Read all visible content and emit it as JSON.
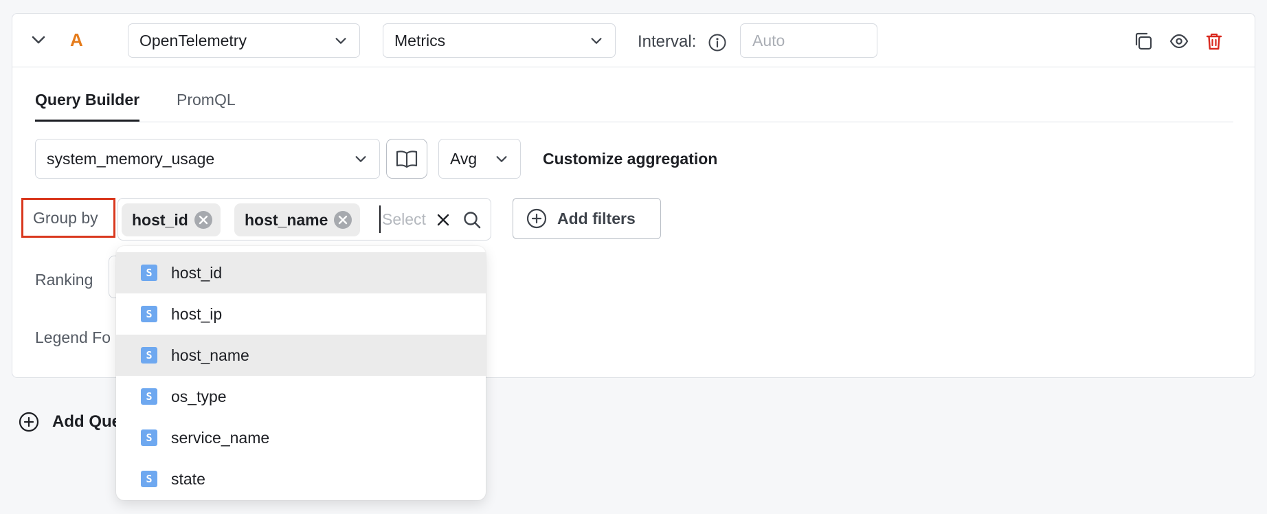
{
  "query": {
    "letter": "A",
    "datasource": "OpenTelemetry",
    "data_type": "Metrics",
    "interval_label": "Interval:",
    "interval_placeholder": "Auto"
  },
  "tabs": [
    {
      "label": "Query Builder",
      "active": true
    },
    {
      "label": "PromQL",
      "active": false
    }
  ],
  "builder": {
    "metric": "system_memory_usage",
    "aggregation": "Avg",
    "customize_aggregation": "Customize aggregation",
    "group_by_label": "Group by",
    "group_by_tags": [
      "host_id",
      "host_name"
    ],
    "group_by_placeholder": "Select",
    "add_filters": "Add filters",
    "ranking_label": "Ranking",
    "legend_label": "Legend Fo"
  },
  "dropdown": {
    "badge": "S",
    "items": [
      {
        "label": "host_id",
        "selected": true
      },
      {
        "label": "host_ip",
        "selected": false
      },
      {
        "label": "host_name",
        "selected": true
      },
      {
        "label": "os_type",
        "selected": false
      },
      {
        "label": "service_name",
        "selected": false
      },
      {
        "label": "state",
        "selected": false
      }
    ]
  },
  "footer": {
    "add_query": "Add Que"
  },
  "colors": {
    "accent_letter": "#e57c1c",
    "delete_icon": "#d9281e",
    "highlight_border": "#d9381e",
    "type_badge": "#6ea8f0"
  }
}
